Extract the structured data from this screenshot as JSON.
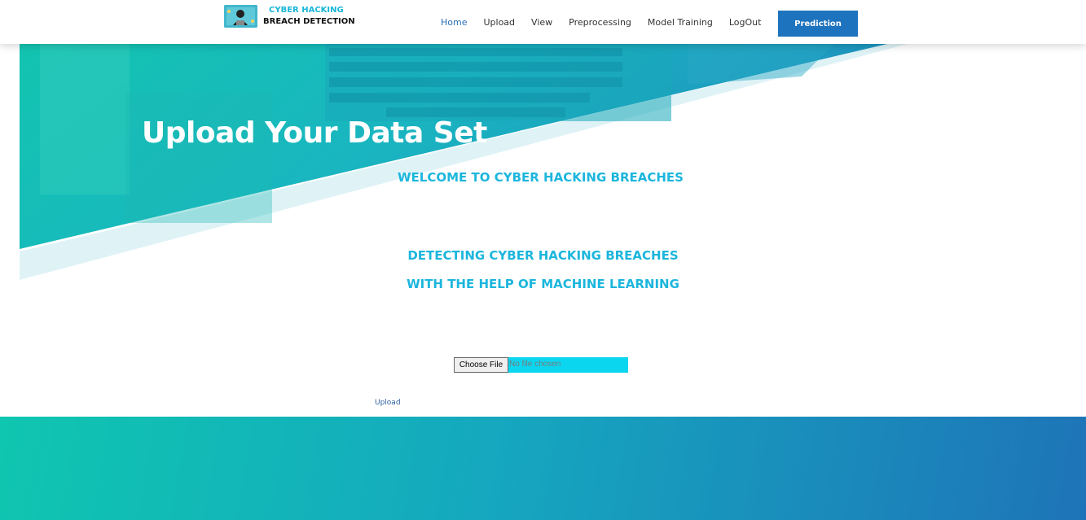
{
  "header": {
    "logo_line1": "CYBER HACKING",
    "logo_line2": "BREACH DETECTION",
    "nav": [
      {
        "label": "Home",
        "active": true
      },
      {
        "label": "Upload"
      },
      {
        "label": "View"
      },
      {
        "label": "Preprocessing"
      },
      {
        "label": "Model Training"
      },
      {
        "label": "LogOut"
      }
    ],
    "prediction_label": "Prediction"
  },
  "hero": {
    "title": "Upload Your Data Set"
  },
  "main": {
    "welcome": "WELCOME TO CYBER HACKING BREACHES",
    "detect_line1": "DETECTING CYBER HACKING BREACHES",
    "detect_line2": "WITH THE HELP OF MACHINE LEARNING",
    "choose_file_label": "Choose File",
    "no_file_text": "No file chosen",
    "upload_label": "Upload"
  },
  "colors": {
    "accent": "#1cb6dd",
    "button": "#1e73be",
    "file_bg": "#0ad6f0"
  }
}
